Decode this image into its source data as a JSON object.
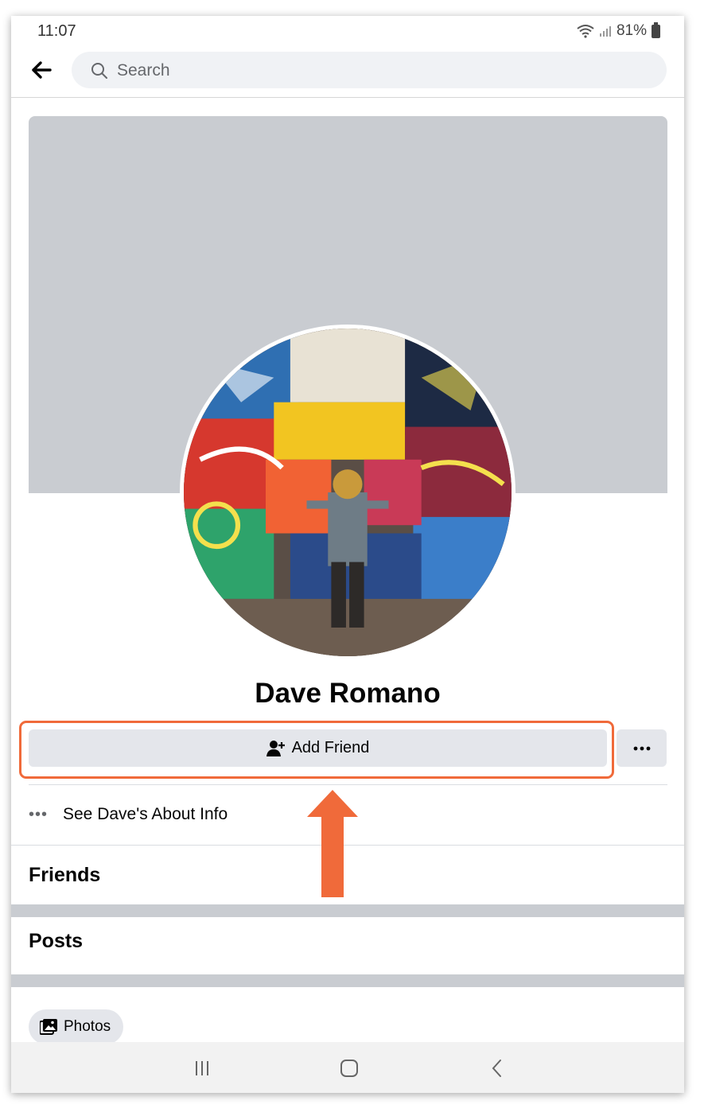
{
  "status_bar": {
    "time": "11:07",
    "battery": "81%"
  },
  "search": {
    "placeholder": "Search"
  },
  "profile": {
    "name": "Dave Romano"
  },
  "actions": {
    "add_friend_label": "Add Friend",
    "more_label": "···"
  },
  "about": {
    "label": "See Dave's About Info",
    "dots": "•••"
  },
  "sections": {
    "friends": "Friends",
    "posts": "Posts"
  },
  "photos_chip": {
    "label": "Photos"
  },
  "colors": {
    "highlight": "#f06a3a",
    "arrow": "#f06a3a",
    "button_bg": "#e4e6eb",
    "cover": "#c9ccd1"
  }
}
